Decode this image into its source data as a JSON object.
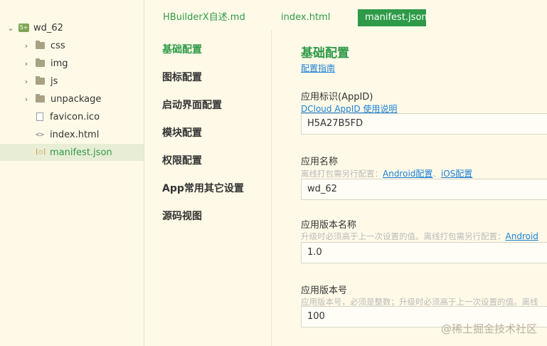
{
  "project": {
    "name": "wd_62",
    "icon": "project-icon",
    "items": [
      {
        "label": "css",
        "type": "folder"
      },
      {
        "label": "img",
        "type": "folder"
      },
      {
        "label": "js",
        "type": "folder"
      },
      {
        "label": "unpackage",
        "type": "folder"
      },
      {
        "label": "favicon.ico",
        "type": "file"
      },
      {
        "label": "index.html",
        "type": "html"
      },
      {
        "label": "manifest.json",
        "type": "json",
        "selected": true
      }
    ]
  },
  "tabs": [
    {
      "label": "HBuilderX自述.md"
    },
    {
      "label": "index.html"
    },
    {
      "label": "manifest.json",
      "active": true
    }
  ],
  "nav": [
    {
      "label": "基础配置",
      "active": true
    },
    {
      "label": "图标配置"
    },
    {
      "label": "启动界面配置"
    },
    {
      "label": "模块配置"
    },
    {
      "label": "权限配置"
    },
    {
      "label": "App常用其它设置"
    },
    {
      "label": "源码视图"
    }
  ],
  "form": {
    "title": "基础配置",
    "guide_link": "配置指南",
    "appid": {
      "label": "应用标识(AppID)",
      "help_link": "DCloud AppID 使用说明",
      "value": "H5A27B5FD"
    },
    "name": {
      "label": "应用名称",
      "hint": "离线打包需另行配置：",
      "android_link": "Android配置",
      "sep": "、",
      "ios_link": "iOS配置",
      "value": "wd_62"
    },
    "version_name": {
      "label": "应用版本名称",
      "hint": "升级时必须高于上一次设置的值。离线打包需另行配置：",
      "android_link": "Android",
      "value": "1.0"
    },
    "version_code": {
      "label": "应用版本号",
      "hint": "应用版本号，必须是整数；升级时必须高于上一次设置的值。离线",
      "value": "100"
    }
  },
  "watermark": "@稀土掘金技术社区",
  "colors": {
    "accent": "#2e9a48",
    "link": "#1a7fd6",
    "background": "#fffae8"
  }
}
